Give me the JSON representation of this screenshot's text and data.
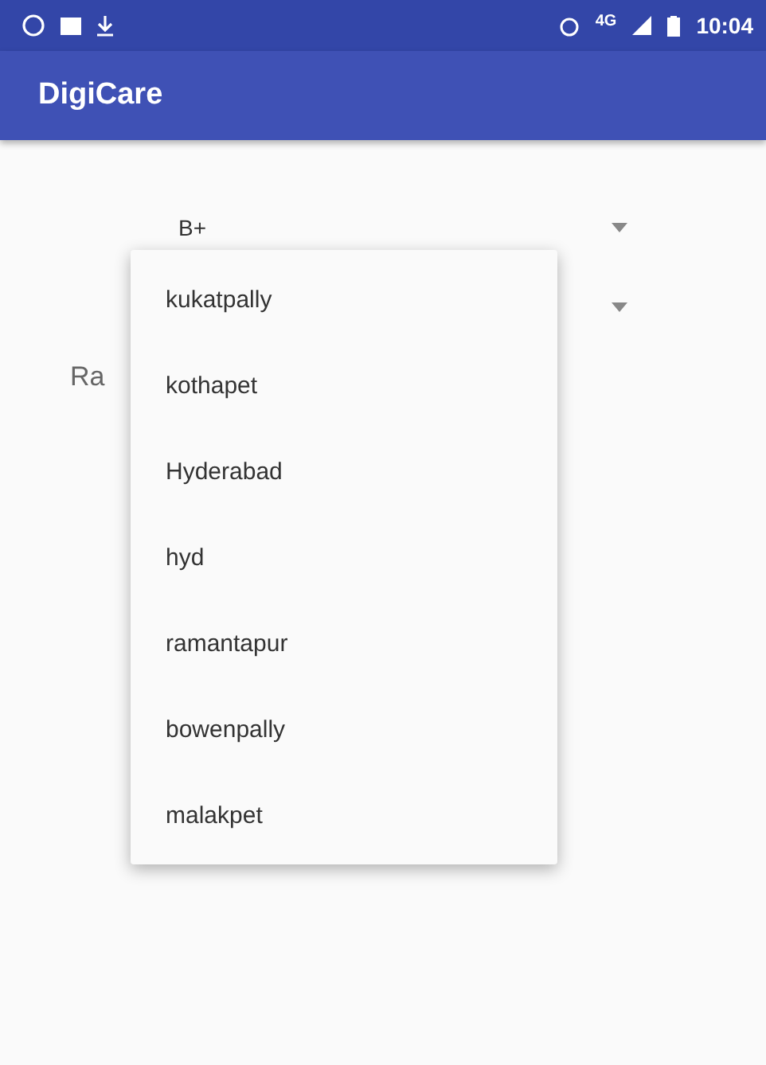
{
  "status_bar": {
    "time": "10:04",
    "network": "4G"
  },
  "app_bar": {
    "title": "DigiCare"
  },
  "spinner": {
    "value": "B+"
  },
  "label": {
    "text": "Ra"
  },
  "dropdown": {
    "options": [
      {
        "label": "kukatpally"
      },
      {
        "label": "kothapet"
      },
      {
        "label": "Hyderabad"
      },
      {
        "label": "hyd"
      },
      {
        "label": "ramantapur"
      },
      {
        "label": "bowenpally"
      },
      {
        "label": "malakpet"
      }
    ]
  }
}
